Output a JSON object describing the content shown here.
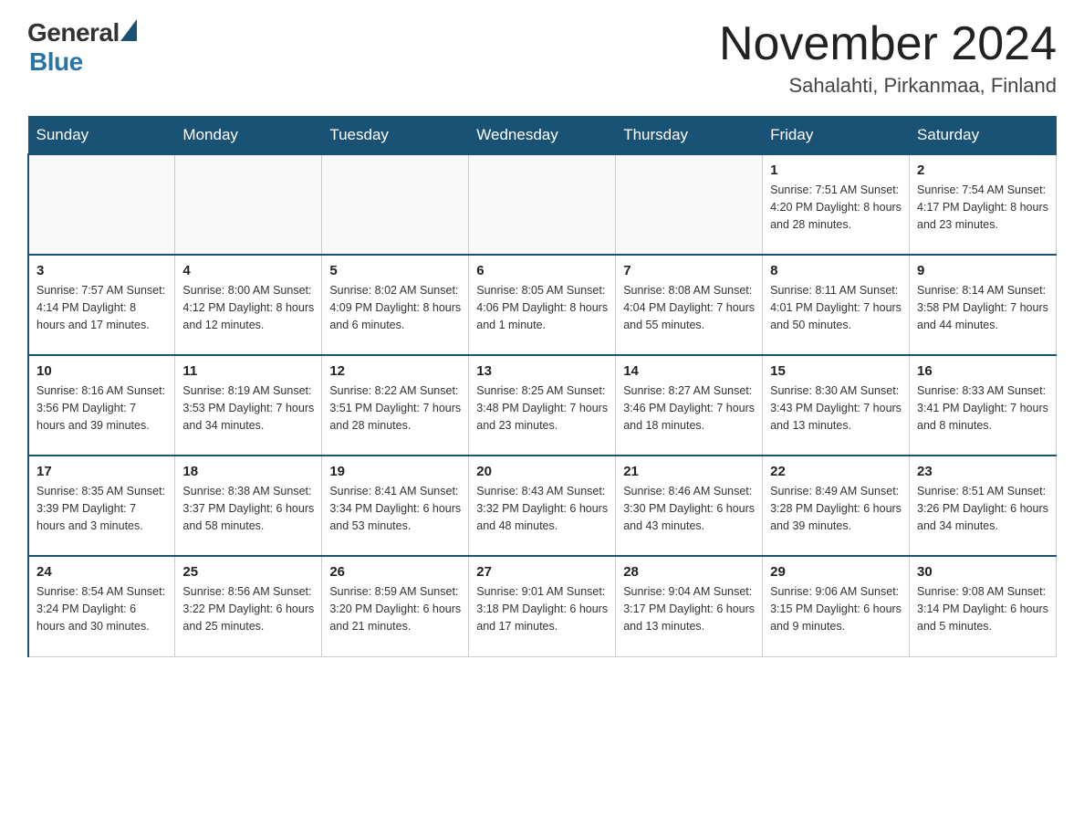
{
  "header": {
    "title": "November 2024",
    "subtitle": "Sahalahti, Pirkanmaa, Finland",
    "logo_general": "General",
    "logo_blue": "Blue"
  },
  "weekdays": [
    "Sunday",
    "Monday",
    "Tuesday",
    "Wednesday",
    "Thursday",
    "Friday",
    "Saturday"
  ],
  "weeks": [
    [
      {
        "day": "",
        "info": ""
      },
      {
        "day": "",
        "info": ""
      },
      {
        "day": "",
        "info": ""
      },
      {
        "day": "",
        "info": ""
      },
      {
        "day": "",
        "info": ""
      },
      {
        "day": "1",
        "info": "Sunrise: 7:51 AM\nSunset: 4:20 PM\nDaylight: 8 hours\nand 28 minutes."
      },
      {
        "day": "2",
        "info": "Sunrise: 7:54 AM\nSunset: 4:17 PM\nDaylight: 8 hours\nand 23 minutes."
      }
    ],
    [
      {
        "day": "3",
        "info": "Sunrise: 7:57 AM\nSunset: 4:14 PM\nDaylight: 8 hours\nand 17 minutes."
      },
      {
        "day": "4",
        "info": "Sunrise: 8:00 AM\nSunset: 4:12 PM\nDaylight: 8 hours\nand 12 minutes."
      },
      {
        "day": "5",
        "info": "Sunrise: 8:02 AM\nSunset: 4:09 PM\nDaylight: 8 hours\nand 6 minutes."
      },
      {
        "day": "6",
        "info": "Sunrise: 8:05 AM\nSunset: 4:06 PM\nDaylight: 8 hours\nand 1 minute."
      },
      {
        "day": "7",
        "info": "Sunrise: 8:08 AM\nSunset: 4:04 PM\nDaylight: 7 hours\nand 55 minutes."
      },
      {
        "day": "8",
        "info": "Sunrise: 8:11 AM\nSunset: 4:01 PM\nDaylight: 7 hours\nand 50 minutes."
      },
      {
        "day": "9",
        "info": "Sunrise: 8:14 AM\nSunset: 3:58 PM\nDaylight: 7 hours\nand 44 minutes."
      }
    ],
    [
      {
        "day": "10",
        "info": "Sunrise: 8:16 AM\nSunset: 3:56 PM\nDaylight: 7 hours\nand 39 minutes."
      },
      {
        "day": "11",
        "info": "Sunrise: 8:19 AM\nSunset: 3:53 PM\nDaylight: 7 hours\nand 34 minutes."
      },
      {
        "day": "12",
        "info": "Sunrise: 8:22 AM\nSunset: 3:51 PM\nDaylight: 7 hours\nand 28 minutes."
      },
      {
        "day": "13",
        "info": "Sunrise: 8:25 AM\nSunset: 3:48 PM\nDaylight: 7 hours\nand 23 minutes."
      },
      {
        "day": "14",
        "info": "Sunrise: 8:27 AM\nSunset: 3:46 PM\nDaylight: 7 hours\nand 18 minutes."
      },
      {
        "day": "15",
        "info": "Sunrise: 8:30 AM\nSunset: 3:43 PM\nDaylight: 7 hours\nand 13 minutes."
      },
      {
        "day": "16",
        "info": "Sunrise: 8:33 AM\nSunset: 3:41 PM\nDaylight: 7 hours\nand 8 minutes."
      }
    ],
    [
      {
        "day": "17",
        "info": "Sunrise: 8:35 AM\nSunset: 3:39 PM\nDaylight: 7 hours\nand 3 minutes."
      },
      {
        "day": "18",
        "info": "Sunrise: 8:38 AM\nSunset: 3:37 PM\nDaylight: 6 hours\nand 58 minutes."
      },
      {
        "day": "19",
        "info": "Sunrise: 8:41 AM\nSunset: 3:34 PM\nDaylight: 6 hours\nand 53 minutes."
      },
      {
        "day": "20",
        "info": "Sunrise: 8:43 AM\nSunset: 3:32 PM\nDaylight: 6 hours\nand 48 minutes."
      },
      {
        "day": "21",
        "info": "Sunrise: 8:46 AM\nSunset: 3:30 PM\nDaylight: 6 hours\nand 43 minutes."
      },
      {
        "day": "22",
        "info": "Sunrise: 8:49 AM\nSunset: 3:28 PM\nDaylight: 6 hours\nand 39 minutes."
      },
      {
        "day": "23",
        "info": "Sunrise: 8:51 AM\nSunset: 3:26 PM\nDaylight: 6 hours\nand 34 minutes."
      }
    ],
    [
      {
        "day": "24",
        "info": "Sunrise: 8:54 AM\nSunset: 3:24 PM\nDaylight: 6 hours\nand 30 minutes."
      },
      {
        "day": "25",
        "info": "Sunrise: 8:56 AM\nSunset: 3:22 PM\nDaylight: 6 hours\nand 25 minutes."
      },
      {
        "day": "26",
        "info": "Sunrise: 8:59 AM\nSunset: 3:20 PM\nDaylight: 6 hours\nand 21 minutes."
      },
      {
        "day": "27",
        "info": "Sunrise: 9:01 AM\nSunset: 3:18 PM\nDaylight: 6 hours\nand 17 minutes."
      },
      {
        "day": "28",
        "info": "Sunrise: 9:04 AM\nSunset: 3:17 PM\nDaylight: 6 hours\nand 13 minutes."
      },
      {
        "day": "29",
        "info": "Sunrise: 9:06 AM\nSunset: 3:15 PM\nDaylight: 6 hours\nand 9 minutes."
      },
      {
        "day": "30",
        "info": "Sunrise: 9:08 AM\nSunset: 3:14 PM\nDaylight: 6 hours\nand 5 minutes."
      }
    ]
  ]
}
